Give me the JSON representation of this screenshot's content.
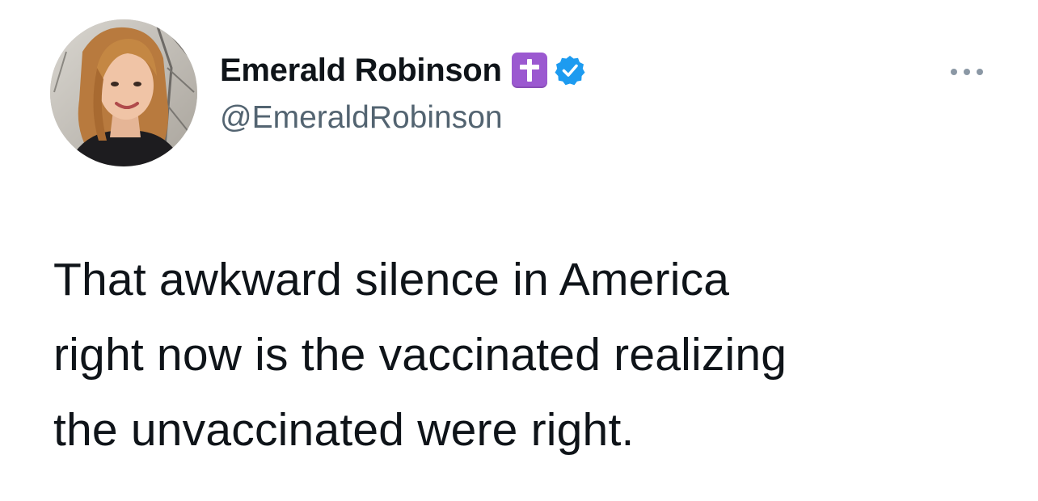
{
  "tweet": {
    "author": {
      "display_name": "Emerald Robinson",
      "handle": "@EmeraldRobinson",
      "name_emoji": "latin-cross-emoji",
      "verified_badge": "verified-badge-icon",
      "avatar": "profile-photo"
    },
    "more_menu_icon": "more-options-icon",
    "text_lines": [
      "That awkward silence in America",
      "right now is the vaccinated realizing",
      "the unvaccinated were right."
    ]
  },
  "colors": {
    "background": "#ffffff",
    "text_primary": "#0f1419",
    "text_secondary": "#536471",
    "verified_blue": "#1d9bf0",
    "emoji_purple": "#9b59d0"
  }
}
